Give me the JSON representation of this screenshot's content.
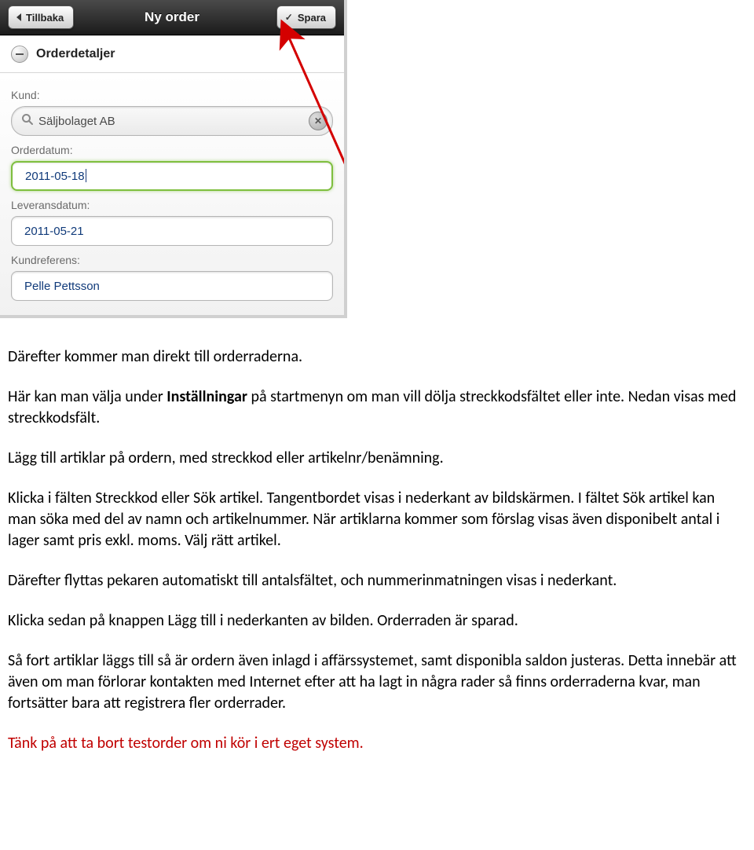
{
  "toolbar": {
    "back_label": "Tillbaka",
    "title": "Ny order",
    "save_label": "Spara"
  },
  "section": {
    "title": "Orderdetaljer"
  },
  "fields": {
    "customer_label": "Kund:",
    "customer_value": "Säljbolaget AB",
    "orderdate_label": "Orderdatum:",
    "orderdate_value": "2011-05-18",
    "delivdate_label": "Leveransdatum:",
    "delivdate_value": "2011-05-21",
    "custref_label": "Kundreferens:",
    "custref_value": "Pelle Pettsson"
  },
  "doc": {
    "p1": "Därefter kommer man direkt till orderraderna.",
    "p2a": "Här kan man välja under ",
    "p2b": "Inställningar",
    "p2c": " på startmenyn om man vill dölja streckkodsfältet eller inte. Nedan visas med streckkodsfält.",
    "p3": "Lägg till artiklar på ordern, med streckkod eller artikelnr/benämning.",
    "p4": "Klicka i fälten Streckkod eller Sök artikel. Tangentbordet visas i nederkant av bildskärmen. I fältet Sök artikel kan man söka med del av namn och artikelnummer. När artiklarna kommer som förslag visas även disponibelt antal i lager samt pris exkl. moms. Välj rätt artikel.",
    "p5": "Därefter flyttas pekaren automatiskt till antalsfältet, och nummerinmatningen visas i nederkant.",
    "p6": "Klicka sedan på knappen Lägg till i nederkanten av bilden. Orderraden är sparad.",
    "p7": "Så fort artiklar läggs till så är ordern även inlagd i affärssystemet, samt disponibla saldon justeras. Detta innebär att även om man förlorar kontakten med Internet efter att ha lagt in några rader så finns orderraderna kvar, man fortsätter bara att registrera fler orderrader.",
    "p8": "Tänk på att ta bort testorder om ni kör i ert eget system."
  }
}
